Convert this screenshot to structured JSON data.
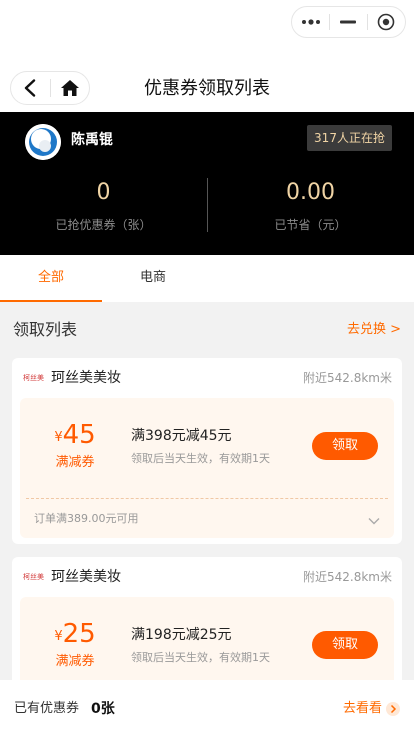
{
  "page_title": "优惠券领取列表",
  "user": {
    "name": "陈禹锟",
    "grab_badge": "317人正在抢"
  },
  "stats": [
    {
      "value": "0",
      "label": "已抢优惠券（张）"
    },
    {
      "value": "0.00",
      "label": "已节省（元）"
    }
  ],
  "tabs": [
    {
      "label": "全部",
      "active": true
    },
    {
      "label": "电商",
      "active": false
    }
  ],
  "list": {
    "title": "领取列表",
    "redeem_link": "去兑换 >"
  },
  "coupons": [
    {
      "shop_logo_text": "柯丝美",
      "shop_name": "珂丝美美妆",
      "distance": "附近542.8km米",
      "currency": "¥",
      "amount": "45",
      "type": "满减券",
      "condition": "满398元减45元",
      "validity": "领取后当天生效，有效期1天",
      "button": "领取",
      "order_min": "订单满389.00元可用"
    },
    {
      "shop_logo_text": "柯丝美",
      "shop_name": "珂丝美美妆",
      "distance": "附近542.8km米",
      "currency": "¥",
      "amount": "25",
      "type": "满减券",
      "condition": "满198元减25元",
      "validity": "领取后当天生效，有效期1天",
      "button": "领取"
    }
  ],
  "bottom": {
    "owned_label": "已有优惠券",
    "owned_count": "0张",
    "goto_label": "去看看"
  },
  "colors": {
    "accent": "#ff6a00",
    "header_bg": "#000000",
    "gold_text": "#f0d4a5",
    "coupon_bg": "#fff7ef"
  },
  "icons": [
    "more-icon",
    "minimize-icon",
    "record-icon",
    "back-arrow-icon",
    "home-icon",
    "chevron-down-icon",
    "arrow-right-icon"
  ]
}
